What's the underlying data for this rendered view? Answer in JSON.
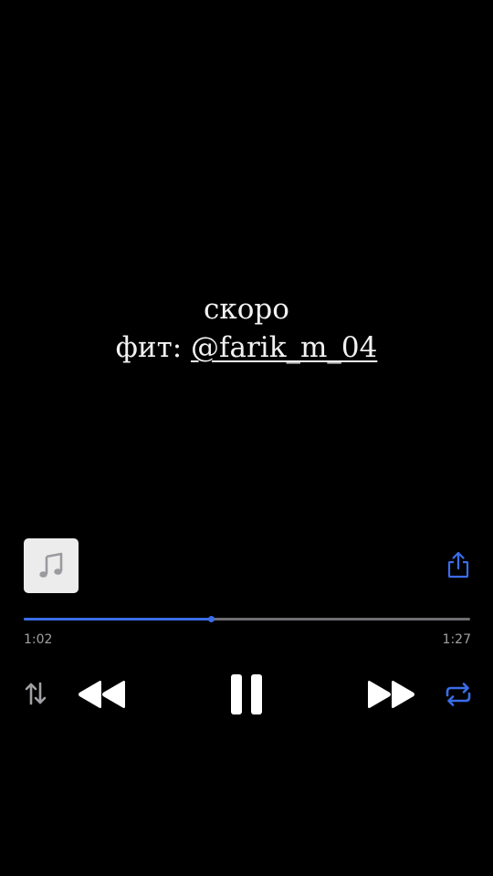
{
  "caption": {
    "line1": "скоро",
    "line2_prefix": "фит: ",
    "line2_mention": "@farik_m_04"
  },
  "player": {
    "artwork_icon": "music-note-icon",
    "share_icon": "share-icon",
    "elapsed": "1:02",
    "total": "1:27",
    "progress_fraction": 0.42,
    "controls": {
      "sort_icon": "sort-arrows-icon",
      "previous_icon": "rewind-icon",
      "play_pause_icon": "pause-icon",
      "next_icon": "fast-forward-icon",
      "repeat_icon": "repeat-icon"
    }
  },
  "colors": {
    "background": "#000000",
    "accent": "#3a6de8",
    "track": "#6e6e73",
    "text": "#f2f2f2",
    "muted_text": "#a0a0a5"
  }
}
